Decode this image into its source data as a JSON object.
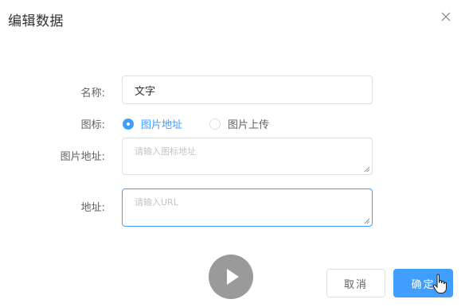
{
  "dialog": {
    "title": "编辑数据",
    "close_icon": "close-icon"
  },
  "form": {
    "name": {
      "label": "名称:",
      "value": "文字"
    },
    "icon": {
      "label": "图标:",
      "options": [
        {
          "label": "图片地址",
          "checked": true
        },
        {
          "label": "图片上传",
          "checked": false
        }
      ]
    },
    "image_url": {
      "label": "图片地址:",
      "placeholder": "请输入图标地址"
    },
    "url": {
      "label": "地址:",
      "placeholder": "请输入URL"
    }
  },
  "footer": {
    "cancel_label": "取消",
    "ok_label": "确定"
  },
  "overlay": {
    "play_icon": "play-icon",
    "cursor_icon": "hand-pointer-icon"
  },
  "colors": {
    "primary": "#409eff",
    "border": "#dcdfe6",
    "placeholder": "#c0c4cc"
  }
}
